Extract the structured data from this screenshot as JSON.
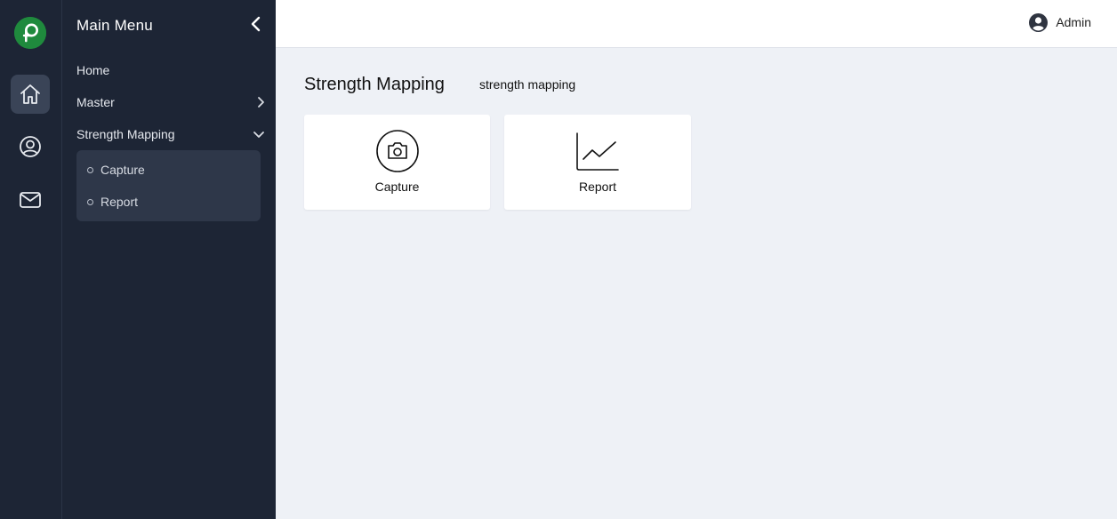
{
  "sidebar": {
    "title": "Main Menu",
    "items": [
      {
        "label": "Home"
      },
      {
        "label": "Master"
      },
      {
        "label": "Strength Mapping"
      }
    ],
    "submenu": [
      {
        "label": "Capture"
      },
      {
        "label": "Report"
      }
    ]
  },
  "rail": {
    "icons": [
      "logo-icon",
      "home-icon",
      "user-circle-icon",
      "mail-icon"
    ],
    "logo_color": "#1f8a3d"
  },
  "header": {
    "user_name": "Admin"
  },
  "main": {
    "title": "Strength Mapping",
    "breadcrumb": "strength mapping",
    "cards": [
      {
        "label": "Capture",
        "icon": "camera-icon"
      },
      {
        "label": "Report",
        "icon": "line-chart-icon"
      }
    ]
  },
  "colors": {
    "sidebar_bg": "#1d2535",
    "content_bg": "#eef1f6",
    "active_rail_bg": "#3a4457",
    "submenu_bg": "#2e3749"
  }
}
